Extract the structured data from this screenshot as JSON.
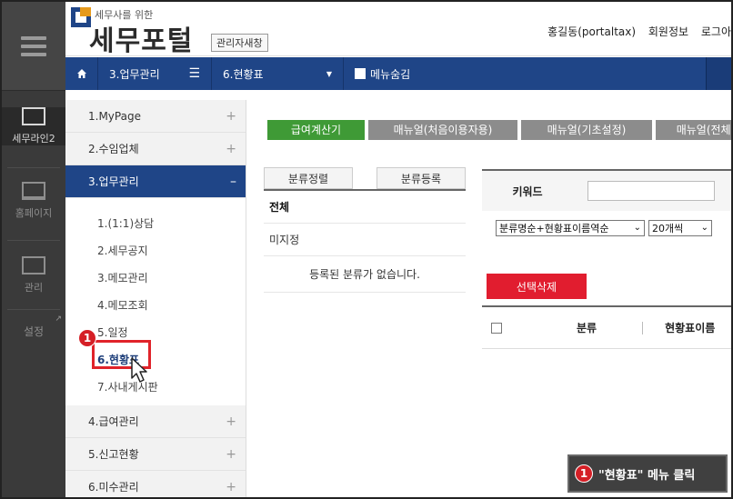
{
  "rail": {
    "items": [
      {
        "label": "세무라인2",
        "icon": "monitor-icon"
      },
      {
        "label": "홈페이지",
        "icon": "laptop-icon"
      },
      {
        "label": "관리",
        "icon": "window-icon"
      },
      {
        "label": "설정",
        "icon": "external-arrow-icon"
      }
    ]
  },
  "header": {
    "logo_small": "세무사를 위한",
    "logo_big": "세무포털",
    "admin_label": "관리자새창",
    "user": "홍길동(portaltax)",
    "member_info": "회원정보",
    "logout": "로그아"
  },
  "navbar": {
    "crumb1": "3.업무관리",
    "crumb2": "6.현황표",
    "hide_menu": "메뉴숨김"
  },
  "sidemenu": {
    "items": [
      {
        "label": "1.MyPage",
        "sign": "+"
      },
      {
        "label": "2.수임업체",
        "sign": "+"
      },
      {
        "label": "3.업무관리",
        "sign": "–"
      }
    ],
    "subitems": [
      "1.(1:1)상담",
      "2.세무공지",
      "3.메모관리",
      "4.메모조회",
      "5.일정",
      "6.현황표",
      "7.사내게시판"
    ],
    "items_after": [
      {
        "label": "4.급여관리",
        "sign": "+"
      },
      {
        "label": "5.신고현황",
        "sign": "+"
      },
      {
        "label": "6.미수관리",
        "sign": "+"
      }
    ]
  },
  "content": {
    "buttons": [
      "급여계산기",
      "매뉴얼(처음이용자용)",
      "매뉴얼(기초설정)",
      "매뉴얼(전체)"
    ],
    "category": {
      "sort_btn": "분류정렬",
      "register_btn": "분류등록",
      "rows": [
        "전체",
        "미지정"
      ],
      "empty": "등록된 분류가 없습니다."
    },
    "search": {
      "keyword_label": "키워드",
      "keyword_value": "",
      "sort_select": "분류명순+현황표이름역순",
      "count_select": "20개씩"
    },
    "delete_btn": "선택삭제",
    "table_headers": [
      "분류",
      "현황표이름"
    ]
  },
  "annotation": {
    "badge": "1",
    "caption": "\"현황표\" 메뉴 클릭"
  },
  "colors": {
    "nav_blue": "#1f4587",
    "green": "#3f9a36",
    "red": "#e11d2f",
    "highlight": "#e0232a"
  }
}
